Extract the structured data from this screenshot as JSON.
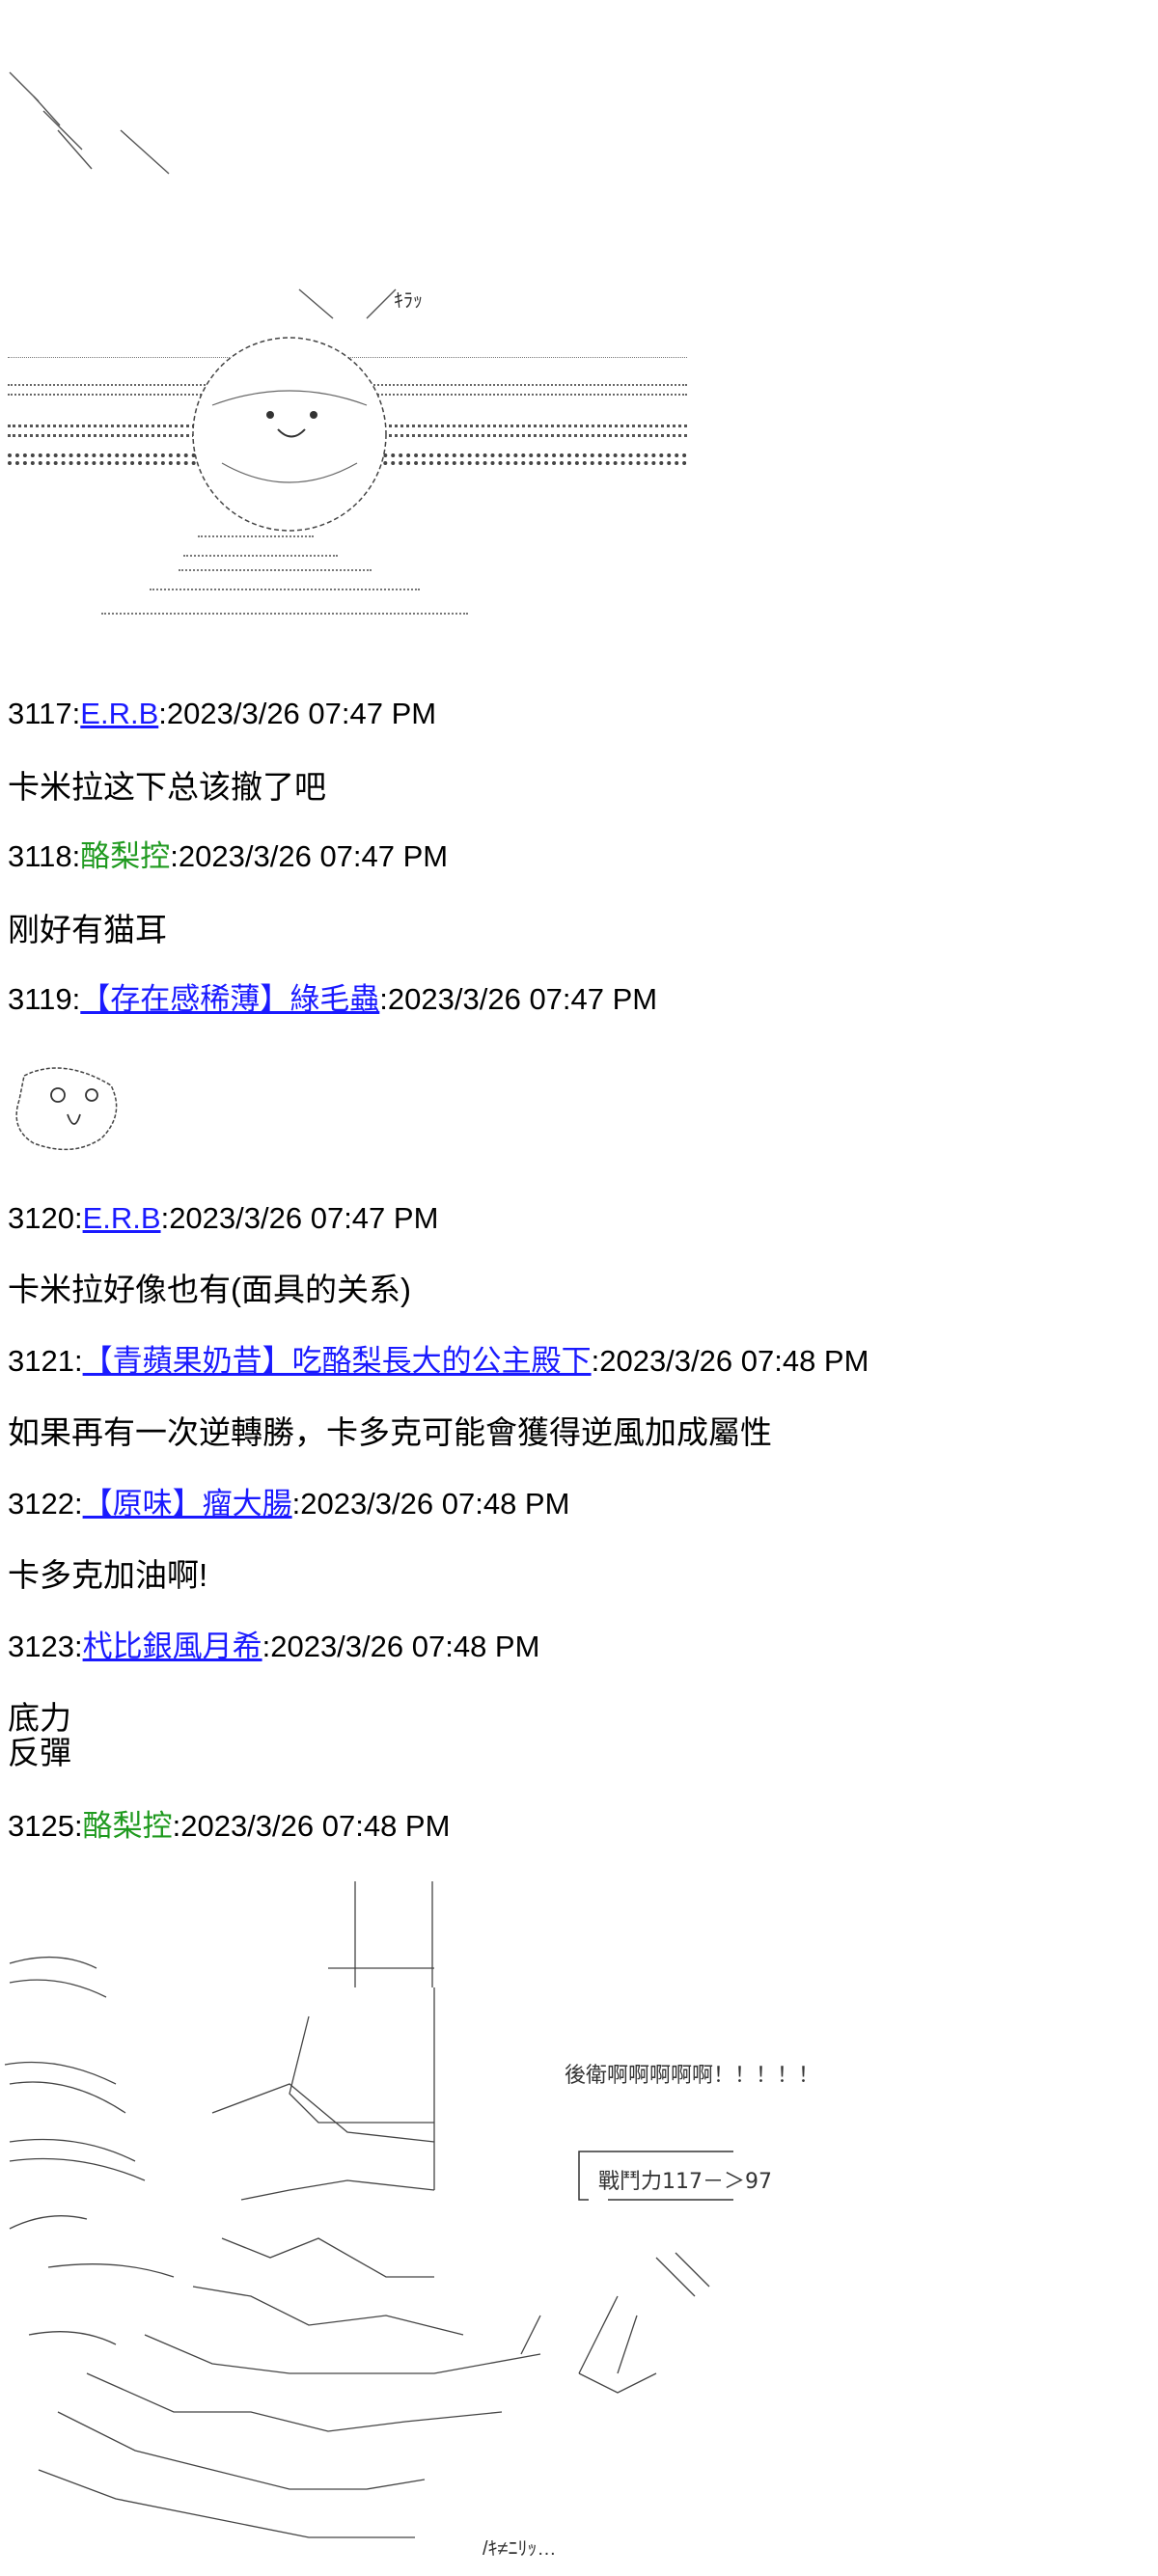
{
  "top_art": {
    "sfx": "ｷﾗｯ"
  },
  "posts": [
    {
      "number": "3117",
      "name": "E.R.B",
      "date": "2023/3/26 07:47 PM",
      "lines": [
        "卡米拉这下总该撤了吧"
      ]
    },
    {
      "number": "3118",
      "name": "酪梨控",
      "date": "2023/3/26 07:47 PM",
      "lines": [
        "刚好有猫耳"
      ]
    },
    {
      "number": "3119",
      "name": "【存在感稀薄】綠毛蟲",
      "date": "2023/3/26 07:47 PM",
      "lines": []
    },
    {
      "number": "3120",
      "name": "E.R.B",
      "date": "2023/3/26 07:47 PM",
      "lines": [
        "卡米拉好像也有(面具的关系)"
      ]
    },
    {
      "number": "3121",
      "name": "【青蘋果奶昔】吃酪梨長大的公主殿下",
      "date": "2023/3/26 07:48 PM",
      "lines": [
        "如果再有一次逆轉勝，卡多克可能會獲得逆風加成屬性"
      ]
    },
    {
      "number": "3122",
      "name": "【原味】瘤大腸",
      "date": "2023/3/26 07:48 PM",
      "lines": [
        "卡多克加油啊!"
      ]
    },
    {
      "number": "3123",
      "name": "杙比銀風月希",
      "date": "2023/3/26 07:48 PM",
      "lines": [
        "底力",
        "反彈"
      ]
    },
    {
      "number": "3125",
      "name": "酪梨控",
      "date": "2023/3/26 07:48 PM",
      "lines": []
    }
  ],
  "bottom_art": {
    "shout": "後衛啊啊啊啊啊！！！！！",
    "power_label": "戰鬥力117－＞97",
    "sfx_bottom": "/ｷ≠ﾆﾘｯ…"
  },
  "colors": {
    "link": "#1a1aff",
    "name_green": "#1f9a1f",
    "text": "#000000"
  }
}
